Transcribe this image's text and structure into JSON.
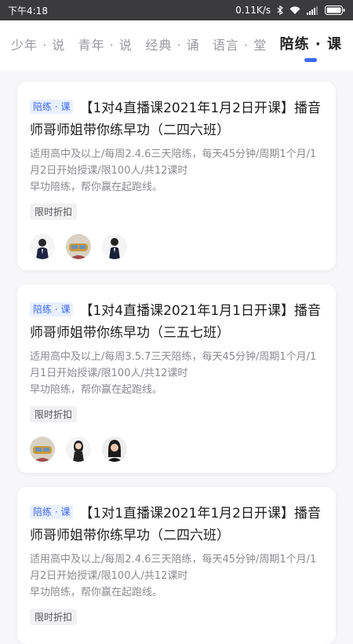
{
  "status_bar": {
    "time": "下午4:18",
    "net_speed": "0.11K/s"
  },
  "tabs": [
    {
      "label": "少年 · 说"
    },
    {
      "label": "青年 · 说"
    },
    {
      "label": "经典 · 诵"
    },
    {
      "label": "语言 · 堂"
    },
    {
      "label": "陪练 · 课",
      "active": true
    }
  ],
  "accent_color": "#3d6af2",
  "cards": [
    {
      "badge": "陪练 · 课",
      "title": "【1对4直播课2021年1月2日开课】播音师哥师姐带你练早功（二四六班）",
      "desc_line1": "适用高中及以上/每周2.4.6三天陪练，每天45分钟/周期1个月/1月2日开始授课/限100人/共12课时",
      "desc_line2": "早功陪练，帮你赢在起跑线。",
      "tag": "限时折扣"
    },
    {
      "badge": "陪练 · 课",
      "title": "【1对4直播课2021年1月1日开课】播音师哥师姐带你练早功（三五七班）",
      "desc_line1": "适用高中及以上/每周3.5.7三天陪练，每天45分钟/周期1个月/1月1日开始授课/限100人/共12课时",
      "desc_line2": "早功陪练，帮你赢在起跑线。",
      "tag": "限时折扣"
    },
    {
      "badge": "陪练 · 课",
      "title": "【1对1直播课2021年1月2日开课】播音师哥师姐带你练早功（二四六班）",
      "desc_line1": "适用高中及以上/每周2.4.6三天陪练，每天45分钟/周期1个月/1月2日开始授课/限100人/共12课时",
      "desc_line2": "早功陪练，帮你赢在起跑线。",
      "tag": "限时折扣"
    }
  ]
}
